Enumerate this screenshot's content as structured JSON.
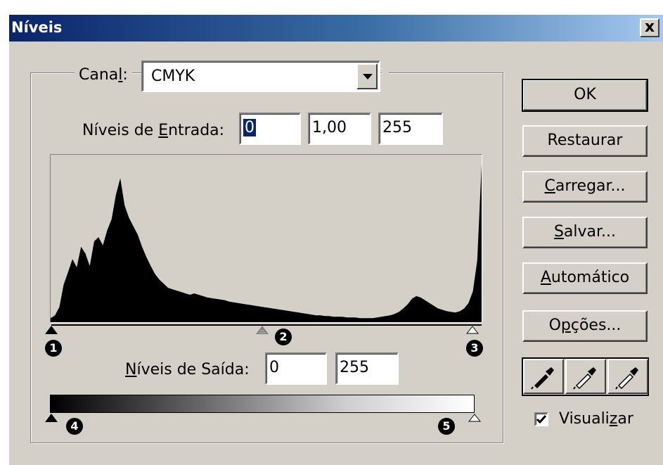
{
  "window": {
    "title": "Níveis",
    "close_label": "x"
  },
  "channel": {
    "label_prefix": "Cana",
    "label_mnemonic": "l",
    "label_suffix": ":",
    "value": "CMYK"
  },
  "input_levels": {
    "label_prefix": "Níveis de ",
    "label_mnemonic": "E",
    "label_suffix": "ntrada:",
    "black": "0",
    "gamma": "1,00",
    "white": "255"
  },
  "output_levels": {
    "label_mnemonic": "N",
    "label_suffix": "íveis de Saída:",
    "black": "0",
    "white": "255"
  },
  "histogram": {
    "description_values": [
      6,
      10,
      22,
      55,
      73,
      92,
      80,
      110,
      100,
      82,
      118,
      124,
      112,
      134,
      150,
      186,
      210,
      170,
      152,
      140,
      128,
      110,
      95,
      82,
      70,
      62,
      56,
      50,
      48,
      46,
      44,
      42,
      40,
      42,
      40,
      38,
      36,
      35,
      34,
      33,
      32,
      30,
      29,
      28,
      27,
      26,
      25,
      24,
      23,
      22,
      21,
      20,
      19,
      18,
      17,
      16,
      15,
      14,
      13,
      12,
      11,
      10,
      10,
      9,
      9,
      8,
      8,
      8,
      7,
      7,
      7,
      6,
      6,
      6,
      6,
      7,
      8,
      9,
      10,
      12,
      15,
      20,
      26,
      34,
      38,
      36,
      32,
      28,
      24,
      20,
      18,
      16,
      15,
      14,
      16,
      20,
      28,
      45,
      90,
      230
    ]
  },
  "callouts": [
    "1",
    "2",
    "3",
    "4",
    "5"
  ],
  "buttons": {
    "ok": "OK",
    "restore": "Restaurar",
    "load_mnemonic": "C",
    "load_rest": "arregar...",
    "save_mnemonic": "S",
    "save_rest": "alvar...",
    "auto_mnemonic": "A",
    "auto_rest": "utomático",
    "options_prefix": "O",
    "options_mnemonic": "p",
    "options_rest": "ções..."
  },
  "preview": {
    "label_prefix": "Visuali",
    "label_mnemonic": "z",
    "label_suffix": "ar",
    "checked": true
  },
  "colors": {
    "dialog_bg": "#d4d0c8",
    "title_start": "#0a246a",
    "title_end": "#a6caf0",
    "selection": "#0a246a"
  }
}
